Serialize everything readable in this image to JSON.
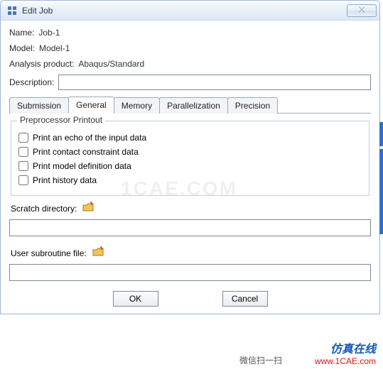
{
  "window": {
    "title": "Edit Job",
    "close_glyph": "⤬"
  },
  "fields": {
    "name_label": "Name:",
    "name_value": "Job-1",
    "model_label": "Model:",
    "model_value": "Model-1",
    "product_label": "Analysis product:",
    "product_value": "Abaqus/Standard",
    "description_label": "Description:",
    "description_value": ""
  },
  "tabs": [
    {
      "label": "Submission"
    },
    {
      "label": "General"
    },
    {
      "label": "Memory"
    },
    {
      "label": "Parallelization"
    },
    {
      "label": "Precision"
    }
  ],
  "active_tab_index": 1,
  "preprocessor": {
    "title": "Preprocessor Printout",
    "options": [
      {
        "label": "Print an echo of the input data",
        "checked": false
      },
      {
        "label": "Print contact constraint data",
        "checked": false
      },
      {
        "label": "Print model definition data",
        "checked": false
      },
      {
        "label": "Print history data",
        "checked": false
      }
    ]
  },
  "scratch": {
    "label": "Scratch directory:",
    "value": ""
  },
  "subroutine": {
    "label": "User subroutine file:",
    "value": ""
  },
  "buttons": {
    "ok": "OK",
    "cancel": "Cancel"
  },
  "overlay": {
    "watermark": "1CAE.COM",
    "wx": "微信扫一扫",
    "brand": "仿真在线",
    "url": "www.1CAE.com"
  }
}
